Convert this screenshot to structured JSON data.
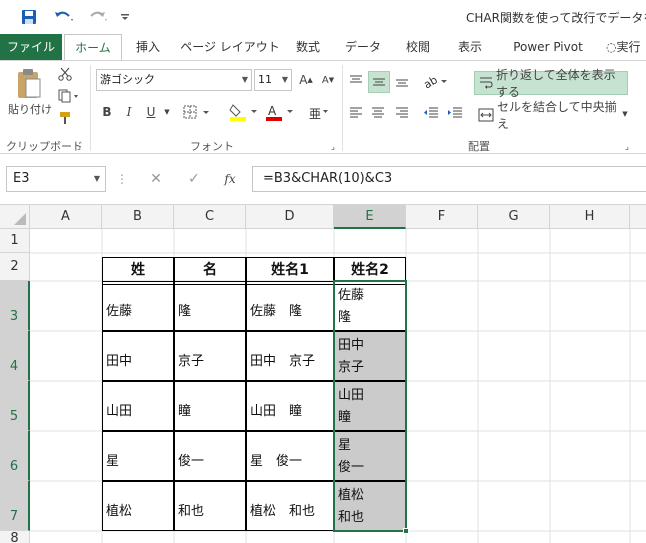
{
  "title": "CHAR関数を使って改行でデータを連結",
  "tabs": [
    "ファイル",
    "ホーム",
    "挿入",
    "ページ レイアウト",
    "数式",
    "データ",
    "校閲",
    "表示",
    "Power Pivot",
    "実行"
  ],
  "ribbon": {
    "paste_label": "貼り付け",
    "clipboard_label": "クリップボード",
    "font_name": "游ゴシック",
    "font_size": "11",
    "font_label": "フォント",
    "bold": "B",
    "italic": "I",
    "underline": "U",
    "wrap_text": "折り返して全体を表示する",
    "merge_center": "セルを結合して中央揃え",
    "alignment_label": "配置"
  },
  "formula_bar": {
    "name_box": "E3",
    "formula": "=B3&CHAR(10)&C3",
    "fx": "fx"
  },
  "columns": [
    "A",
    "B",
    "C",
    "D",
    "E",
    "F",
    "G",
    "H"
  ],
  "rows": [
    "1",
    "2",
    "3",
    "4",
    "5",
    "6",
    "7",
    "8"
  ],
  "table": {
    "headers": [
      "姓",
      "名",
      "姓名1",
      "姓名2"
    ],
    "rows": [
      {
        "sei": "佐藤",
        "mei": "隆",
        "seimei1": "佐藤　隆",
        "seimei2_l1": "佐藤",
        "seimei2_l2": "隆"
      },
      {
        "sei": "田中",
        "mei": "京子",
        "seimei1": "田中　京子",
        "seimei2_l1": "田中",
        "seimei2_l2": "京子"
      },
      {
        "sei": "山田",
        "mei": "瞳",
        "seimei1": "山田　瞳",
        "seimei2_l1": "山田",
        "seimei2_l2": "瞳"
      },
      {
        "sei": "星",
        "mei": "俊一",
        "seimei1": "星　俊一",
        "seimei2_l1": "星",
        "seimei2_l2": "俊一"
      },
      {
        "sei": "植松",
        "mei": "和也",
        "seimei1": "植松　和也",
        "seimei2_l1": "植松",
        "seimei2_l2": "和也"
      }
    ]
  },
  "colors": {
    "excel_green": "#217346",
    "selection_fill": "#cbcbcb",
    "wrap_highlight": "#c6e2d0"
  }
}
